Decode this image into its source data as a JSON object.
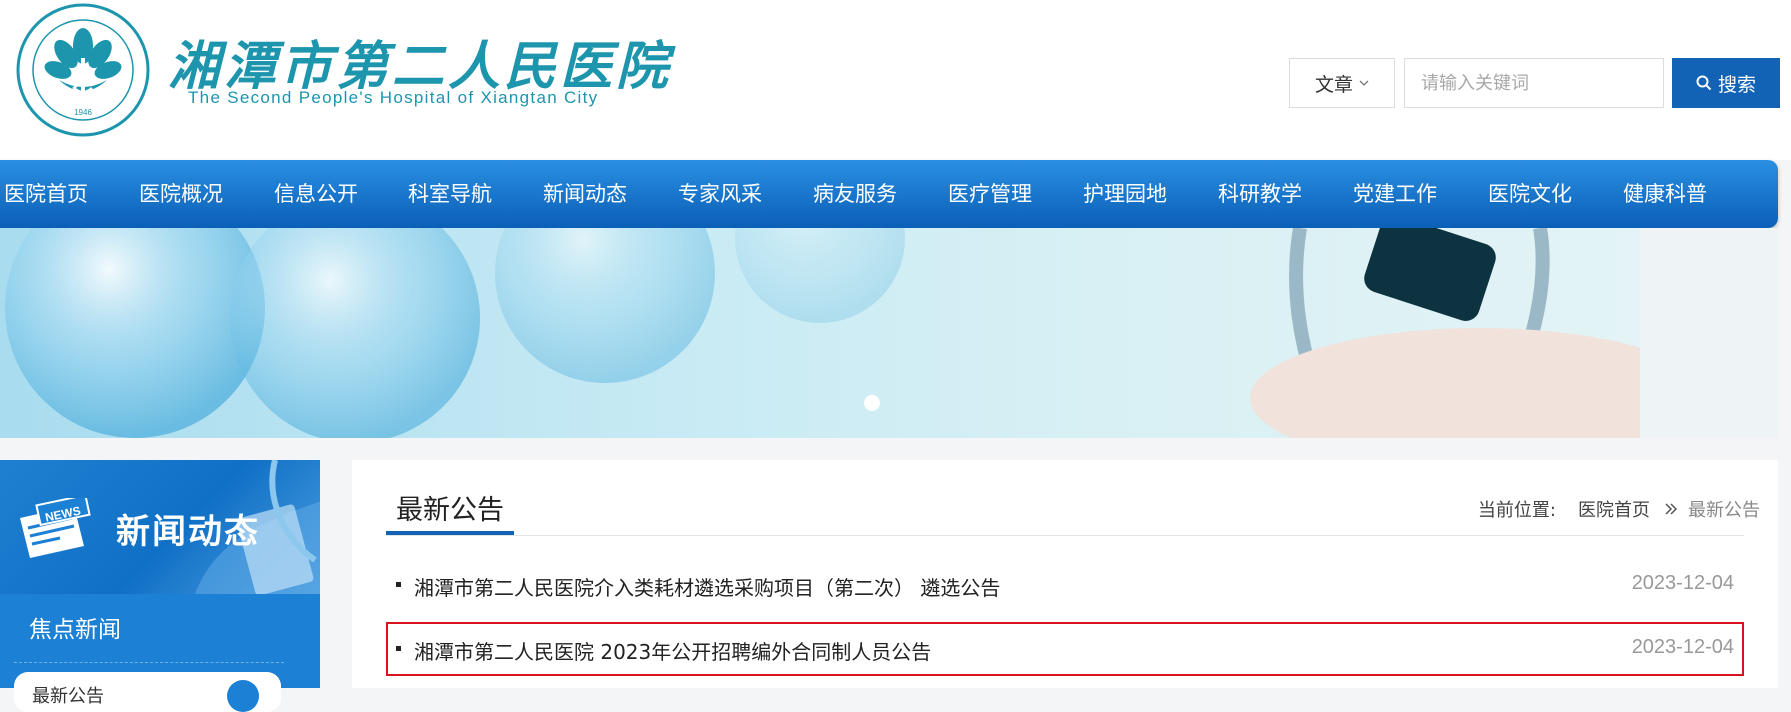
{
  "header": {
    "logo_cn": "湘潭市第二人民医院",
    "logo_en": "The Second People's Hospital of Xiangtan City",
    "emblem_year": "1946",
    "search": {
      "type_label": "文章",
      "placeholder": "请输入关键词",
      "button_label": "搜索"
    }
  },
  "nav": {
    "items": [
      "医院首页",
      "医院概况",
      "信息公开",
      "科室导航",
      "新闻动态",
      "专家风采",
      "病友服务",
      "医疗管理",
      "护理园地",
      "科研教学",
      "党建工作",
      "医院文化",
      "健康科普"
    ]
  },
  "sidebar": {
    "title": "新闻动态",
    "icon_text": "NEWS",
    "items": [
      "焦点新闻"
    ],
    "sub_label": "最新公告"
  },
  "content": {
    "title": "最新公告",
    "breadcrumb": {
      "label": "当前位置:",
      "home": "医院首页",
      "current": "最新公告"
    },
    "news": [
      {
        "title": "湘潭市第二人民医院介入类耗材遴选采购项目（第二次） 遴选公告",
        "date": "2023-12-04"
      },
      {
        "title": "湘潭市第二人民医院 2023年公开招聘编外合同制人员公告",
        "date": "2023-12-04",
        "highlighted": true
      }
    ]
  },
  "colors": {
    "brand_teal": "#1c95ad",
    "nav_blue": "#1262b6",
    "highlight_red": "#d9141c"
  }
}
